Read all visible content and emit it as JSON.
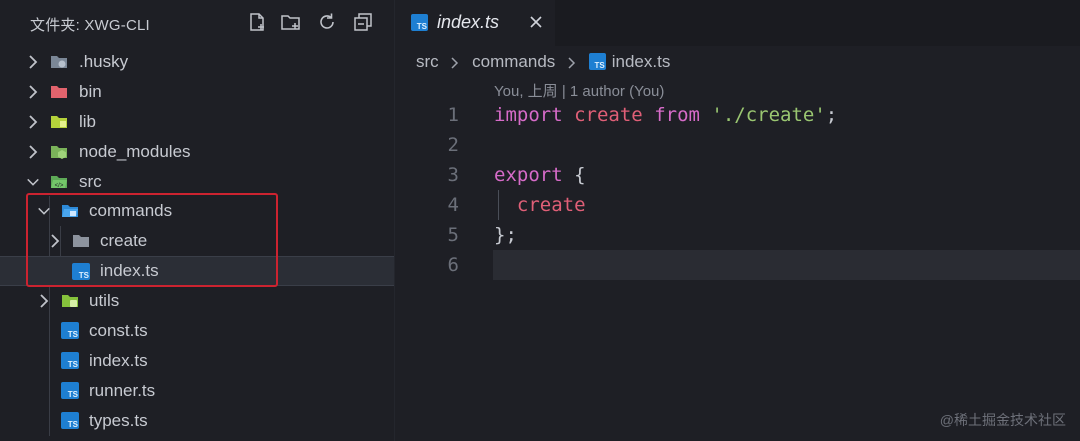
{
  "explorer": {
    "title": "文件夹: XWG-CLI",
    "actions": [
      "new-file",
      "new-folder",
      "refresh",
      "collapse-all"
    ],
    "items": [
      {
        "label": ".husky",
        "type": "folder",
        "expanded": false,
        "icon": "husky-folder-icon"
      },
      {
        "label": "bin",
        "type": "folder",
        "expanded": false,
        "icon": "bin-folder-icon"
      },
      {
        "label": "lib",
        "type": "folder",
        "expanded": false,
        "icon": "lib-folder-icon"
      },
      {
        "label": "node_modules",
        "type": "folder",
        "expanded": false,
        "icon": "node-folder-icon"
      },
      {
        "label": "src",
        "type": "folder",
        "expanded": true,
        "icon": "src-folder-icon"
      },
      {
        "label": "commands",
        "type": "folder",
        "expanded": true,
        "icon": "commands-folder-icon"
      },
      {
        "label": "create",
        "type": "folder",
        "expanded": false,
        "icon": "folder-icon"
      },
      {
        "label": "index.ts",
        "type": "file",
        "selected": true,
        "icon": "typescript-file-icon"
      },
      {
        "label": "utils",
        "type": "folder",
        "expanded": false,
        "icon": "utils-folder-icon"
      },
      {
        "label": "const.ts",
        "type": "file",
        "icon": "typescript-file-icon"
      },
      {
        "label": "index.ts",
        "type": "file",
        "icon": "typescript-file-icon"
      },
      {
        "label": "runner.ts",
        "type": "file",
        "icon": "typescript-file-icon"
      },
      {
        "label": "types.ts",
        "type": "file",
        "icon": "typescript-file-icon"
      }
    ]
  },
  "editor": {
    "tab": {
      "label": "index.ts",
      "badge": "TS"
    },
    "breadcrumb": [
      "src",
      "commands",
      "index.ts"
    ],
    "codelens": "You, 上周 | 1 author (You)",
    "lines": [
      {
        "n": "1",
        "tokens": [
          [
            "kw",
            "import"
          ],
          [
            "punc",
            " "
          ],
          [
            "id",
            "create"
          ],
          [
            "punc",
            " "
          ],
          [
            "kw",
            "from"
          ],
          [
            "punc",
            " "
          ],
          [
            "str",
            "'./create'"
          ],
          [
            "punc",
            ";"
          ]
        ]
      },
      {
        "n": "2",
        "tokens": []
      },
      {
        "n": "3",
        "tokens": [
          [
            "kw",
            "export"
          ],
          [
            "punc",
            " {"
          ]
        ]
      },
      {
        "n": "4",
        "tokens": [
          [
            "punc",
            "  "
          ],
          [
            "id",
            "create"
          ]
        ]
      },
      {
        "n": "5",
        "tokens": [
          [
            "punc",
            "};"
          ]
        ]
      },
      {
        "n": "6",
        "tokens": []
      }
    ],
    "active_line": "6"
  },
  "colors": {
    "keyword": "#d66bc8",
    "identifier": "#e05f77",
    "string": "#9ac671",
    "highlight_box": "#cc2330",
    "ts_badge": "#1e7fd2"
  },
  "watermark": "@稀土掘金技术社区"
}
